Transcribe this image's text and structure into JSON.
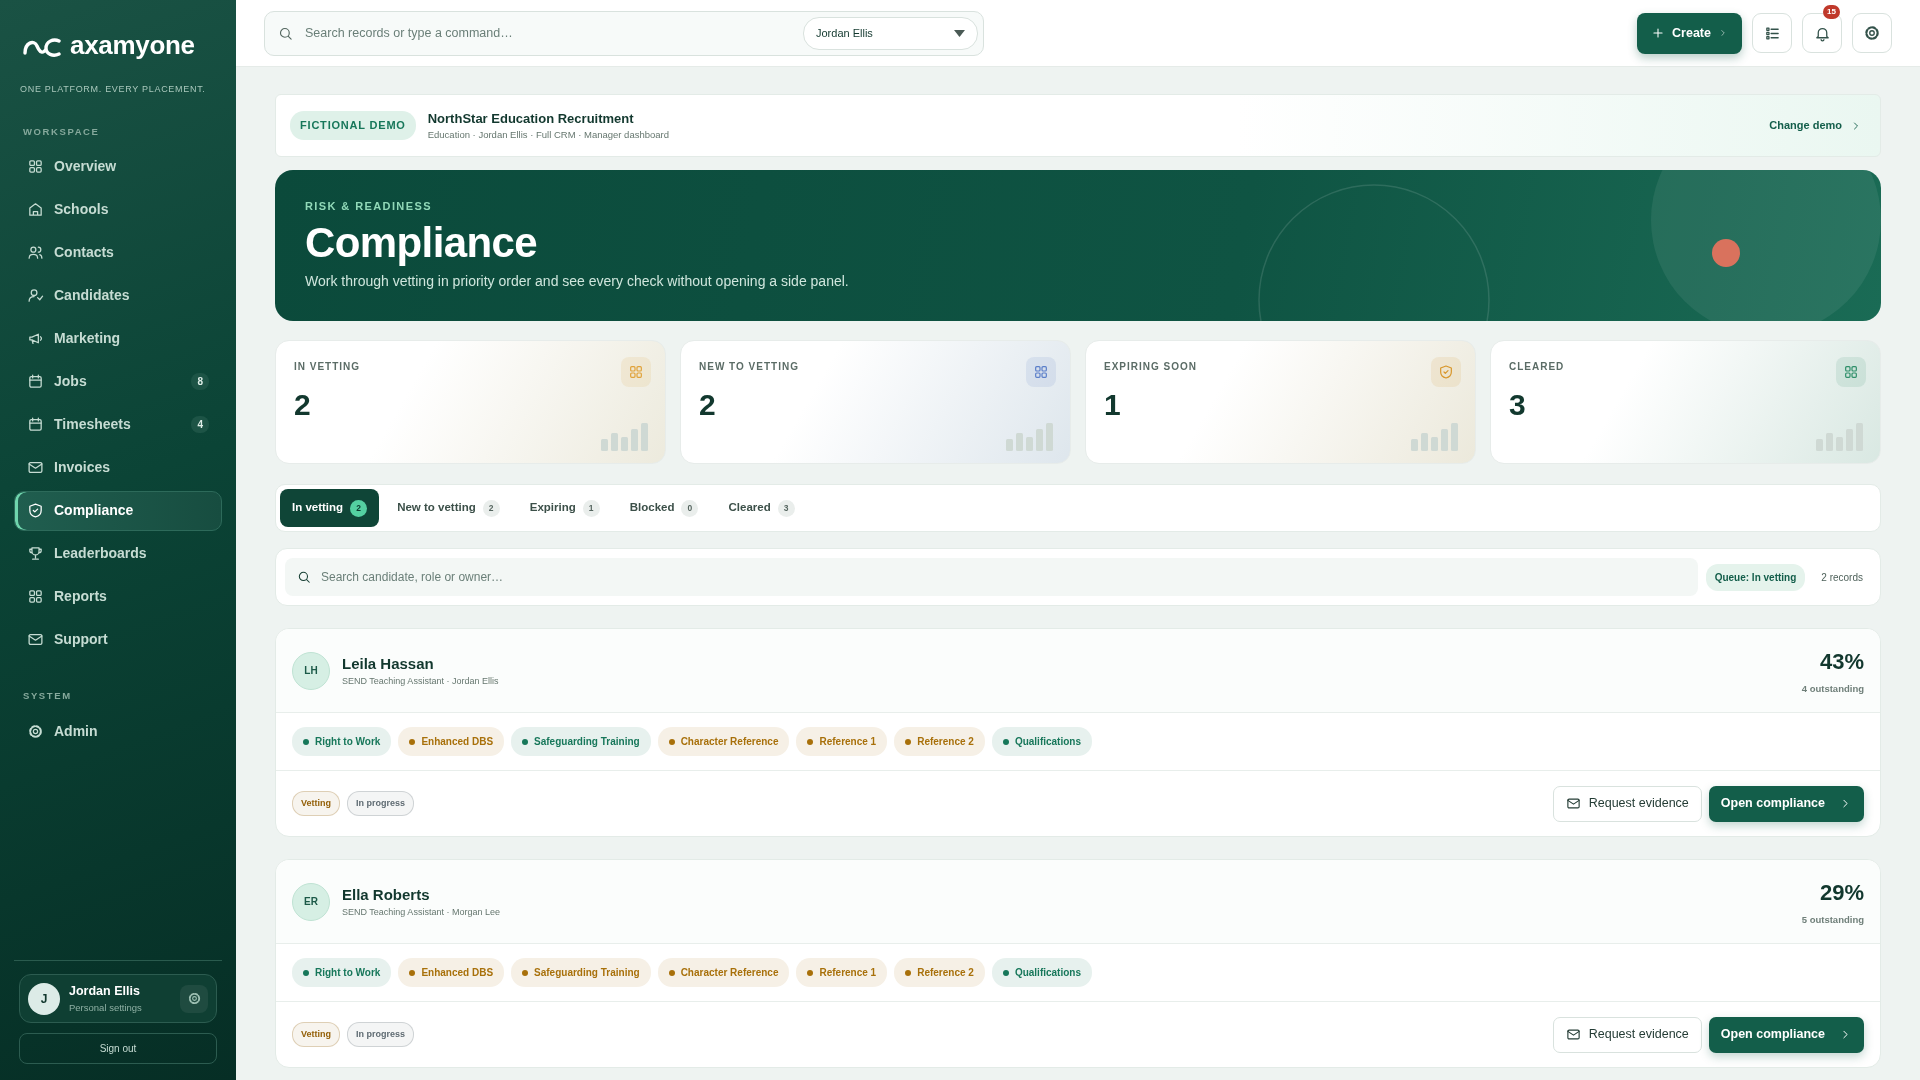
{
  "sidebar": {
    "brand": "axamyone",
    "tagline": "ONE PLATFORM. EVERY PLACEMENT.",
    "sections": [
      {
        "title": "WORKSPACE",
        "items": [
          {
            "label": "Overview",
            "selected": false
          },
          {
            "label": "Schools",
            "selected": false
          },
          {
            "label": "Contacts",
            "selected": false
          },
          {
            "label": "Candidates",
            "selected": false
          },
          {
            "label": "Marketing",
            "selected": false
          },
          {
            "label": "Jobs",
            "badge": "8",
            "selected": false
          },
          {
            "label": "Timesheets",
            "badge": "4",
            "selected": false
          },
          {
            "label": "Invoices",
            "selected": false
          },
          {
            "label": "Compliance",
            "selected": true
          },
          {
            "label": "Leaderboards",
            "selected": false
          },
          {
            "label": "Reports",
            "selected": false
          },
          {
            "label": "Support",
            "selected": false
          }
        ]
      },
      {
        "title": "SYSTEM",
        "items": [
          {
            "label": "Admin",
            "selected": false
          }
        ]
      }
    ],
    "user": {
      "initial": "J",
      "name": "Jordan Ellis",
      "subtitle": "Personal settings"
    },
    "sign_out": "Sign out"
  },
  "topbar": {
    "search_placeholder": "Search records or type a command…",
    "user_select": "Jordan Ellis",
    "create": "Create",
    "notifications": "15"
  },
  "demo": {
    "tag": "FICTIONAL DEMO",
    "title": "NorthStar Education Recruitment",
    "subtitle": "Education · Jordan Ellis · Full CRM · Manager dashboard",
    "action": "Change demo"
  },
  "hero": {
    "eyebrow": "RISK & READINESS",
    "title": "Compliance",
    "description": "Work through vetting in priority order and see every check without opening a side panel."
  },
  "stats": [
    {
      "label": "IN VETTING",
      "value": "2",
      "color": "#e0a23a"
    },
    {
      "label": "NEW TO VETTING",
      "value": "2",
      "color": "#5b7fc9"
    },
    {
      "label": "EXPIRING SOON",
      "value": "1",
      "color": "#d8962a"
    },
    {
      "label": "CLEARED",
      "value": "3",
      "color": "#2f8f6a"
    }
  ],
  "tabs": [
    {
      "label": "In vetting",
      "count": "2",
      "selected": true
    },
    {
      "label": "New to vetting",
      "count": "2",
      "selected": false
    },
    {
      "label": "Expiring",
      "count": "1",
      "selected": false
    },
    {
      "label": "Blocked",
      "count": "0",
      "selected": false
    },
    {
      "label": "Cleared",
      "count": "3",
      "selected": false
    }
  ],
  "queue": {
    "placeholder": "Search candidate, role or owner…",
    "filter": "Queue: In vetting",
    "count": "2 records"
  },
  "candidates": [
    {
      "initials": "LH",
      "name": "Leila Hassan",
      "meta": "SEND Teaching Assistant · Jordan Ellis",
      "percent": "43%",
      "outstanding": "4 outstanding",
      "checks": [
        {
          "label": "Right to Work",
          "color": "#17775a"
        },
        {
          "label": "Enhanced DBS",
          "color": "#a8700a"
        },
        {
          "label": "Safeguarding Training",
          "color": "#17775a"
        },
        {
          "label": "Character Reference",
          "color": "#a8700a"
        },
        {
          "label": "Reference 1",
          "color": "#a8700a"
        },
        {
          "label": "Reference 2",
          "color": "#a8700a"
        },
        {
          "label": "Qualifications",
          "color": "#17775a"
        }
      ],
      "tags": [
        {
          "label": "Vetting",
          "color": "#94610a"
        },
        {
          "label": "In progress",
          "color": "#5f6b72"
        }
      ],
      "actions": [
        "Request evidence",
        "Open compliance"
      ]
    },
    {
      "initials": "ER",
      "name": "Ella Roberts",
      "meta": "SEND Teaching Assistant · Morgan Lee",
      "percent": "29%",
      "outstanding": "5 outstanding",
      "checks": [
        {
          "label": "Right to Work",
          "color": "#17775a"
        },
        {
          "label": "Enhanced DBS",
          "color": "#a8700a"
        },
        {
          "label": "Safeguarding Training",
          "color": "#a8700a"
        },
        {
          "label": "Character Reference",
          "color": "#a8700a"
        },
        {
          "label": "Reference 1",
          "color": "#a8700a"
        },
        {
          "label": "Reference 2",
          "color": "#a8700a"
        },
        {
          "label": "Qualifications",
          "color": "#17775a"
        }
      ],
      "tags": [
        {
          "label": "Vetting",
          "color": "#94610a"
        },
        {
          "label": "In progress",
          "color": "#5f6b72"
        }
      ],
      "actions": [
        "Request evidence",
        "Open compliance"
      ]
    }
  ]
}
